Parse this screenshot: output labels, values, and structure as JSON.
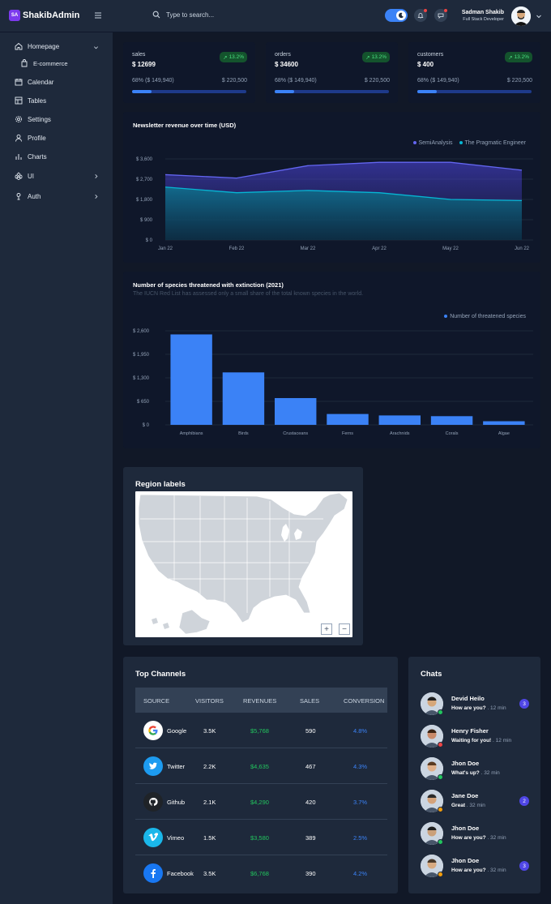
{
  "app": {
    "logo_badge": "SA",
    "logo_text": "ShakibAdmin"
  },
  "header": {
    "search_placeholder": "Type to search...",
    "user_name": "Sadman Shakib",
    "user_role": "Full Stack Developer"
  },
  "sidebar": {
    "items": [
      {
        "label": "Homepage",
        "icon": "home-icon"
      },
      {
        "label": "E-commerce",
        "icon": "bag-icon"
      },
      {
        "label": "Calendar",
        "icon": "calendar-icon"
      },
      {
        "label": "Tables",
        "icon": "table-icon"
      },
      {
        "label": "Settings",
        "icon": "gear-icon"
      },
      {
        "label": "Profile",
        "icon": "user-icon"
      },
      {
        "label": "Charts",
        "icon": "bar-chart-icon"
      },
      {
        "label": "UI",
        "icon": "components-icon"
      },
      {
        "label": "Auth",
        "icon": "lock-icon"
      }
    ]
  },
  "stats": [
    {
      "label": "sales",
      "value": "$ 12699",
      "badge": "13.2%",
      "pct": "68% ($ 149,940)",
      "total": "$ 220,500",
      "progress": 0.17
    },
    {
      "label": "orders",
      "value": "$ 34600",
      "badge": "13.2%",
      "pct": "68% ($ 149,940)",
      "total": "$ 220,500",
      "progress": 0.17
    },
    {
      "label": "customers",
      "value": "$ 400",
      "badge": "13.2%",
      "pct": "68% ($ 149,940)",
      "total": "$ 220,500",
      "progress": 0.17
    }
  ],
  "chart_data": [
    {
      "type": "area",
      "title": "Newsletter revenue over time (USD)",
      "x": [
        "Jan 22",
        "Feb 22",
        "Mar 22",
        "Apr 22",
        "May 22",
        "Jun 22"
      ],
      "y_ticks": [
        "$ 3,600",
        "$ 2,700",
        "$ 1,800",
        "$ 900",
        "$ 0"
      ],
      "ylim": [
        0,
        3600
      ],
      "series": [
        {
          "name": "SemiAnalysis",
          "values": [
            2900,
            2750,
            3300,
            3450,
            3450,
            3100
          ],
          "color": "#6366f1"
        },
        {
          "name": "The Pragmatic Engineer",
          "values": [
            2350,
            2100,
            2200,
            2100,
            1800,
            1750
          ],
          "color": "#06b6d4"
        }
      ],
      "legend": "top-right",
      "grid": true
    },
    {
      "type": "bar",
      "title": "Number of species threatened with extinction (2021)",
      "subtitle": "The IUCN Red List has assessed only a small share of the total known species in the world.",
      "categories": [
        "Amphibians",
        "Birds",
        "Crustaceans",
        "Ferns",
        "Arachnids",
        "Corals",
        "Algae"
      ],
      "values": [
        2500,
        1450,
        740,
        300,
        260,
        240,
        100
      ],
      "y_ticks": [
        "$ 0",
        "$ 650",
        "$ 1,300",
        "$ 1,950",
        "$ 2,600"
      ],
      "ylim": [
        0,
        2600
      ],
      "series": [
        {
          "name": "Number of threatened species",
          "color": "#3b82f6"
        }
      ],
      "legend": "top-right",
      "grid": true
    }
  ],
  "map": {
    "title": "Region labels",
    "zoom_in": "+",
    "zoom_out": "−"
  },
  "channels": {
    "title": "Top Channels",
    "columns": [
      "SOURCE",
      "VISITORS",
      "REVENUES",
      "SALES",
      "CONVERSION"
    ],
    "rows": [
      {
        "source": "Google",
        "visitors": "3.5K",
        "revenues": "$5,768",
        "sales": "590",
        "conversion": "4.8%",
        "icon": "google-icon"
      },
      {
        "source": "Twitter",
        "visitors": "2.2K",
        "revenues": "$4,635",
        "sales": "467",
        "conversion": "4.3%",
        "icon": "twitter-icon"
      },
      {
        "source": "Github",
        "visitors": "2.1K",
        "revenues": "$4,290",
        "sales": "420",
        "conversion": "3.7%",
        "icon": "github-icon"
      },
      {
        "source": "Vimeo",
        "visitors": "1.5K",
        "revenues": "$3,580",
        "sales": "389",
        "conversion": "2.5%",
        "icon": "vimeo-icon"
      },
      {
        "source": "Facebook",
        "visitors": "3.5K",
        "revenues": "$6,768",
        "sales": "390",
        "conversion": "4.2%",
        "icon": "facebook-icon"
      }
    ]
  },
  "chats": {
    "title": "Chats",
    "items": [
      {
        "name": "Devid Heilo",
        "msg": "How are you?",
        "time": ". 12 min",
        "badge": "3",
        "status": "#22c55e"
      },
      {
        "name": "Henry Fisher",
        "msg": "Waiting for you!",
        "time": ". 12 min",
        "badge": "",
        "status": "#ef4444"
      },
      {
        "name": "Jhon Doe",
        "msg": "What's up?",
        "time": ". 32 min",
        "badge": "",
        "status": "#22c55e"
      },
      {
        "name": "Jane Doe",
        "msg": "Great",
        "time": ". 32 min",
        "badge": "2",
        "status": "#f59e0b"
      },
      {
        "name": "Jhon Doe",
        "msg": "How are you?",
        "time": ". 32 min",
        "badge": "",
        "status": "#22c55e"
      },
      {
        "name": "Jhon Doe",
        "msg": "How are you?",
        "time": ". 32 min",
        "badge": "3",
        "status": "#f59e0b"
      }
    ]
  }
}
